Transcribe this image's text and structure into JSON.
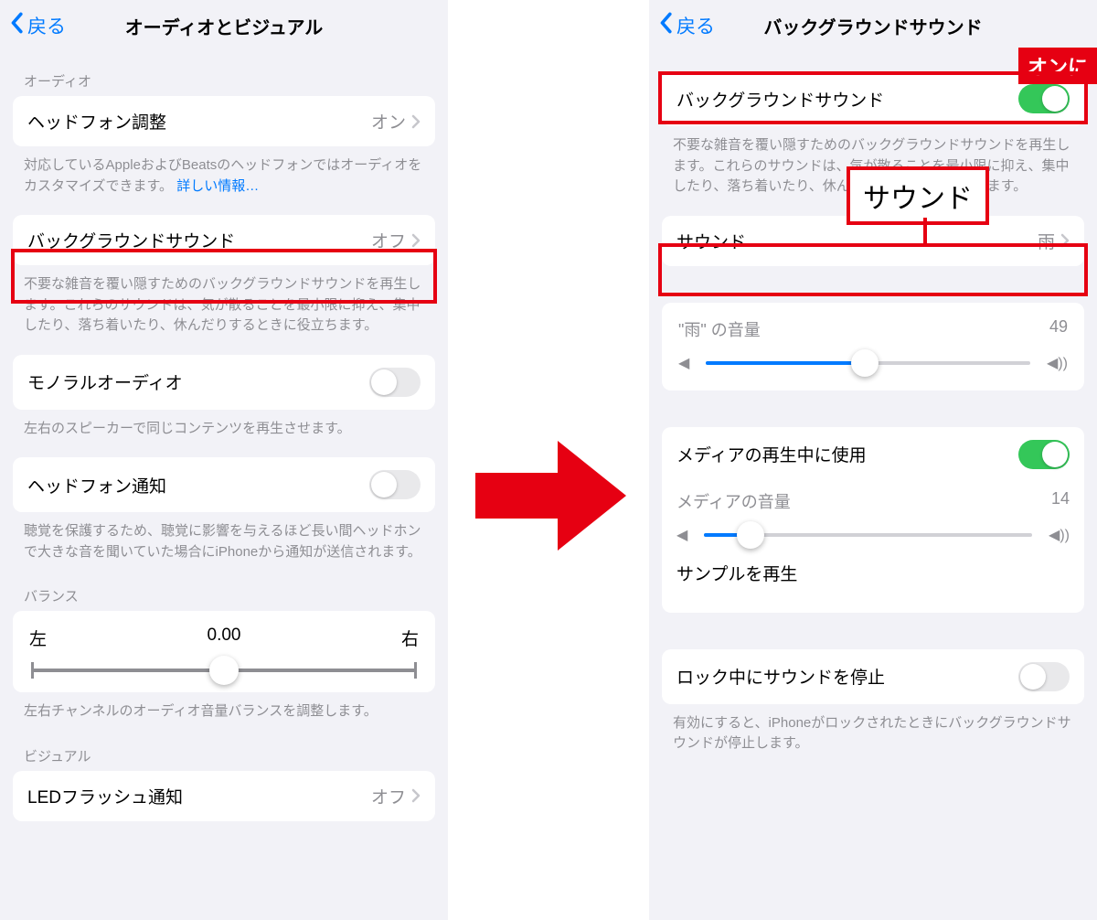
{
  "left": {
    "back": "戻る",
    "title": "オーディオとビジュアル",
    "section_audio": "オーディオ",
    "headphone_adjust": {
      "label": "ヘッドフォン調整",
      "value": "オン"
    },
    "headphone_footer_1": "対応しているAppleおよびBeatsのヘッドフォンではオーディオをカスタマイズできます。",
    "headphone_footer_link": "詳しい情報…",
    "bg_sound": {
      "label": "バックグラウンドサウンド",
      "value": "オフ"
    },
    "bg_sound_footer": "不要な雑音を覆い隠すためのバックグラウンドサウンドを再生します。これらのサウンドは、気が散ることを最小限に抑え、集中したり、落ち着いたり、休んだりするときに役立ちます。",
    "mono": {
      "label": "モノラルオーディオ"
    },
    "mono_footer": "左右のスピーカーで同じコンテンツを再生させます。",
    "hp_notify": {
      "label": "ヘッドフォン通知"
    },
    "hp_notify_footer": "聴覚を保護するため、聴覚に影響を与えるほど長い間ヘッドホンで大きな音を聞いていた場合にiPhoneから通知が送信されます。",
    "balance_header": "バランス",
    "balance_left": "左",
    "balance_center": "0.00",
    "balance_right": "右",
    "balance_footer": "左右チャンネルのオーディオ音量バランスを調整します。",
    "section_visual": "ビジュアル",
    "led_flash": {
      "label": "LEDフラッシュ通知",
      "value": "オフ"
    }
  },
  "right": {
    "back": "戻る",
    "title": "バックグラウンドサウンド",
    "bg_toggle": {
      "label": "バックグラウンドサウンド"
    },
    "bg_footer": "不要な雑音を覆い隠すためのバックグラウンドサウンドを再生します。これらのサウンドは、気が散ることを最小限に抑え、集中したり、落ち着いたり、休んだりするときに役立ちます。",
    "sound_row": {
      "label": "サウンド",
      "value": "雨"
    },
    "volume_label": "\"雨\" の音量",
    "volume_value": "49",
    "media_use": {
      "label": "メディアの再生中に使用"
    },
    "media_vol_label": "メディアの音量",
    "media_vol_value": "14",
    "play_sample": "サンプルを再生",
    "lock_stop": {
      "label": "ロック中にサウンドを停止"
    },
    "lock_footer": "有効にすると、iPhoneがロックされたときにバックグラウンドサウンドが停止します。"
  },
  "annotations": {
    "on_tag": "オンに",
    "sound_callout": "サウンド"
  }
}
